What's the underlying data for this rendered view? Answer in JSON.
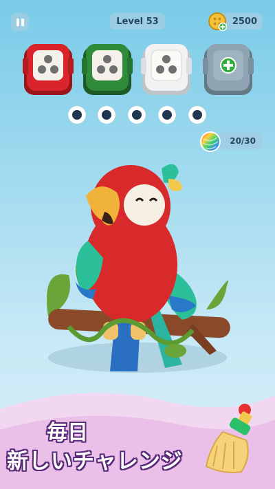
{
  "hud": {
    "level_label": "Level 53",
    "coin_count": "2500",
    "yarn_progress": "20/30"
  },
  "boxes": [
    {
      "color": "#d8242a",
      "state": "filled"
    },
    {
      "color": "#2f8a3a",
      "state": "filled"
    },
    {
      "color": "#f2f2f2",
      "state": "filled"
    },
    {
      "color": "#8ea4b2",
      "state": "locked"
    }
  ],
  "slots_count": 5,
  "banner": {
    "line1": "毎日",
    "line2": "新しいチャレンジ"
  }
}
